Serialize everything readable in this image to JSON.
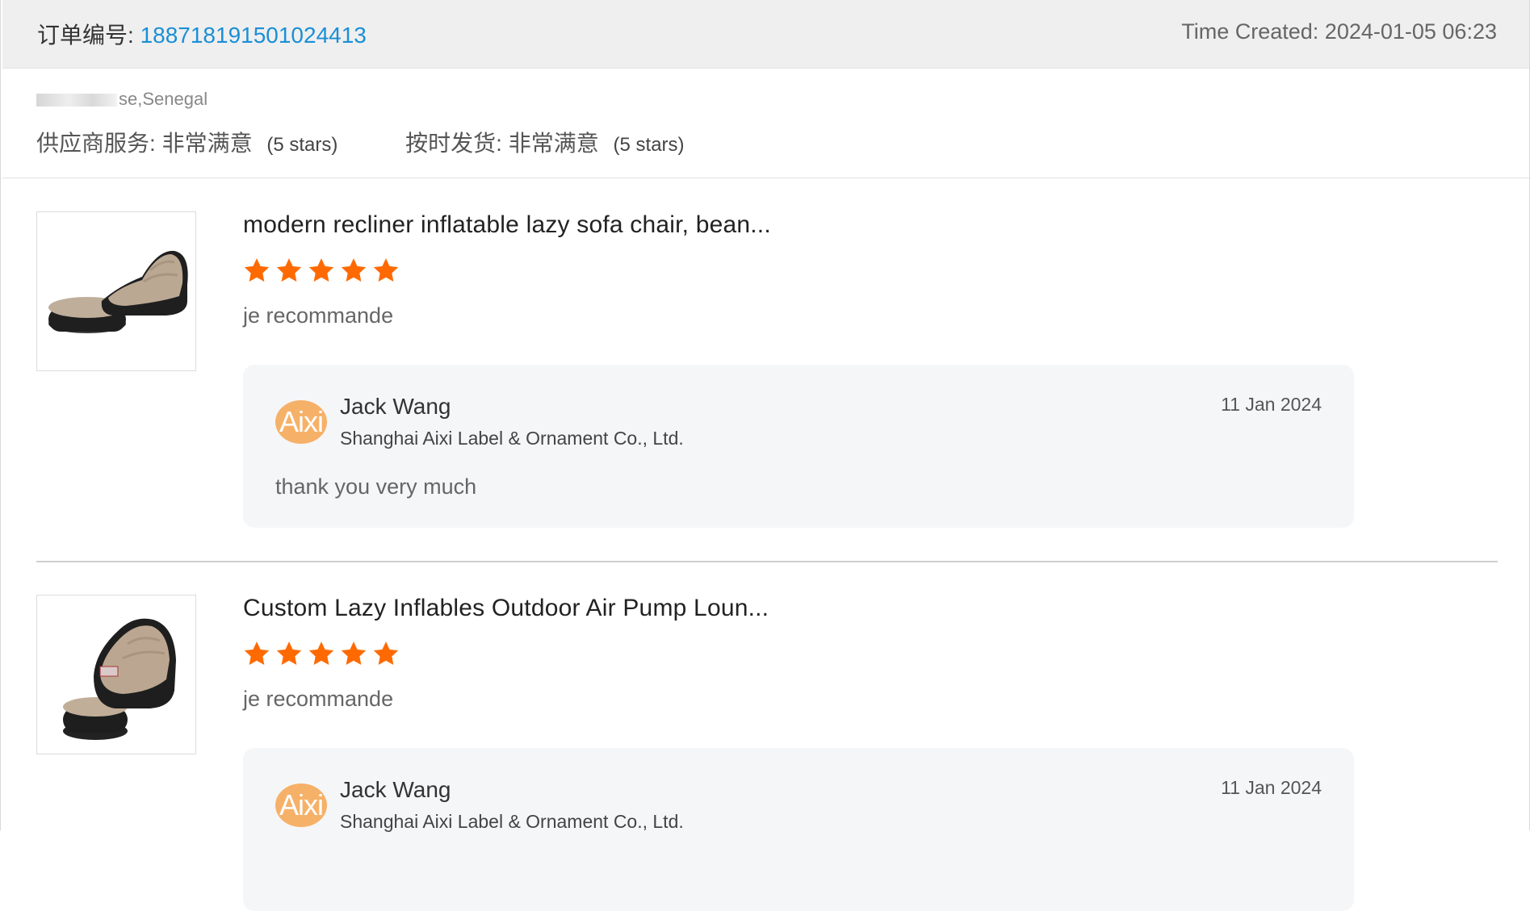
{
  "header": {
    "order_label": "订单编号:",
    "order_number": "188718191501024413",
    "time_created": "Time Created: 2024-01-05 06:23"
  },
  "buyer": {
    "location": "se,Senegal"
  },
  "ratings": [
    {
      "label": "供应商服务:",
      "value": "非常满意",
      "stars_text": "(5 stars)"
    },
    {
      "label": "按时发货:",
      "value": "非常满意",
      "stars_text": "(5 stars)"
    }
  ],
  "reviews": [
    {
      "title": "modern recliner inflatable lazy sofa chair, bean...",
      "rating": 5,
      "text": "je recommande",
      "reply": {
        "avatar_text": "Aixi",
        "name": "Jack Wang",
        "company": "Shanghai Aixi Label & Ornament Co., Ltd.",
        "date": "11 Jan 2024",
        "message": "thank you very much"
      }
    },
    {
      "title": "Custom Lazy Inflables Outdoor Air Pump Loun...",
      "rating": 5,
      "text": "je recommande",
      "reply": {
        "avatar_text": "Aixi",
        "name": "Jack Wang",
        "company": "Shanghai Aixi Label & Ornament Co., Ltd.",
        "date": "11 Jan 2024",
        "message": ""
      }
    }
  ],
  "colors": {
    "star": "#ff6a00",
    "link": "#1a8fd6",
    "avatar": "#f6b169"
  },
  "icons": {
    "star": "star-icon",
    "product_image": "inflatable-chair-image"
  }
}
